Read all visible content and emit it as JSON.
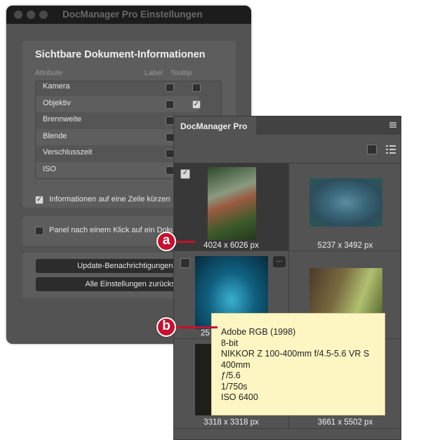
{
  "settings_window": {
    "title": "DocManager Pro Einstellungen",
    "section_title": "Sichtbare Dokument-Informationen",
    "columns": {
      "attribute": "Attribute",
      "label": "Label",
      "tooltip": "Tooltip"
    },
    "attributes": [
      {
        "name": "Kamera",
        "label": false,
        "tooltip": false
      },
      {
        "name": "Objektiv",
        "label": false,
        "tooltip": true
      },
      {
        "name": "Brennweite",
        "label": false,
        "tooltip": false
      },
      {
        "name": "Blende",
        "label": false,
        "tooltip": false
      },
      {
        "name": "Verschlusszeit",
        "label": false,
        "tooltip": false
      },
      {
        "name": "ISO",
        "label": false,
        "tooltip": false
      }
    ],
    "shorten_option": {
      "label": "Informationen auf eine Zeile kürzen",
      "checked": true
    },
    "panel_option": {
      "label": "Panel nach einem Klick auf ein Dokum",
      "checked": false
    },
    "buttons": {
      "reset_updates": "Update-Benachrichtigungen zurück",
      "reset_all": "Alle Einstellungen zurücksetze"
    }
  },
  "panel": {
    "tab": "DocManager Pro",
    "items": [
      {
        "size": "4024 x 6026 px",
        "checked": true
      },
      {
        "size": "5237 x 3492 px"
      },
      {
        "size": "25",
        "checked": false
      },
      {
        "size": ""
      },
      {
        "size": "3318 x 3318 px"
      },
      {
        "size": "3661 x 5502 px"
      }
    ],
    "more_button": "···"
  },
  "tooltip": {
    "lines": [
      "Adobe RGB (1998)",
      "8-bit",
      "NIKKOR Z 100-400mm f/4.5-5.6 VR S",
      "400mm",
      "ƒ/5.6",
      "1/750s",
      "ISO 6400"
    ]
  },
  "annotations": {
    "a": "a",
    "b": "b"
  },
  "colors": {
    "accent": "#c8102e",
    "tooltip_bg": "#fdf6c3"
  }
}
